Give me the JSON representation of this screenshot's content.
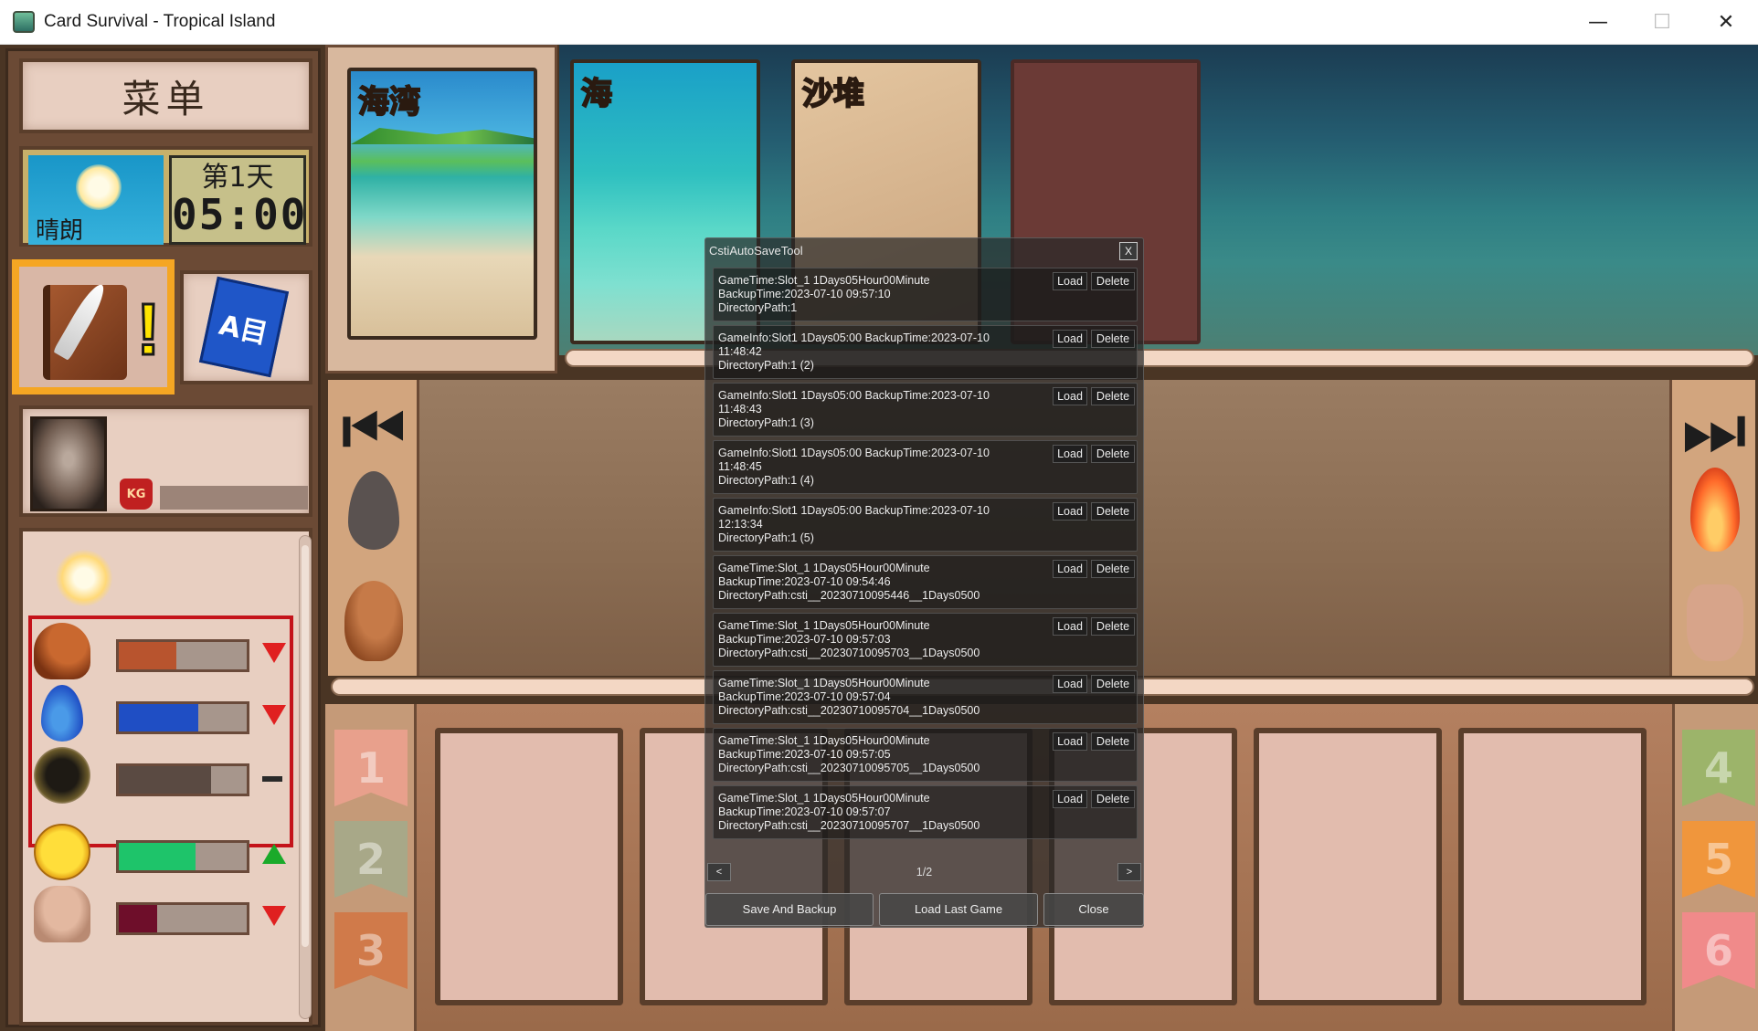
{
  "window": {
    "title": "Card Survival - Tropical Island",
    "minimize": "—",
    "maximize": "☐",
    "close": "✕"
  },
  "sidebar": {
    "menu_label": "菜单",
    "weather_label": "晴朗",
    "day_label": "第1天",
    "time_label": "05:00",
    "weight_badge": "KG",
    "guide_book_label": "A目"
  },
  "stats": [
    {
      "name": "food",
      "fill_percent": 45,
      "color": "#b8542e",
      "trend": "down"
    },
    {
      "name": "water",
      "fill_percent": 62,
      "color": "#1f4ec4",
      "trend": "down"
    },
    {
      "name": "stamina",
      "fill_percent": 72,
      "color": "#5a4a42",
      "trend": "flat"
    },
    {
      "name": "morale",
      "fill_percent": 60,
      "color": "#1ec46a",
      "trend": "up"
    },
    {
      "name": "health",
      "fill_percent": 30,
      "color": "#6e0e2a",
      "trend": "down"
    }
  ],
  "location_cards": {
    "bay": "海湾",
    "sea": "海",
    "sand": "沙堆"
  },
  "nav": {
    "prev": "⏮",
    "next": "⏭"
  },
  "tabs_left": [
    "1",
    "2",
    "3"
  ],
  "tabs_right": [
    "4",
    "5",
    "6"
  ],
  "dialog": {
    "title": "CstiAutoSaveTool",
    "close_label": "X",
    "load_label": "Load",
    "delete_label": "Delete",
    "entries": [
      "GameTime:Slot_1 1Days05Hour00Minute\nBackupTime:2023-07-10 09:57:10\nDirectoryPath:1",
      "GameInfo:Slot1 1Days05:00  BackupTime:2023-07-10\n11:48:42\nDirectoryPath:1 (2)",
      "GameInfo:Slot1 1Days05:00  BackupTime:2023-07-10\n11:48:43\nDirectoryPath:1 (3)",
      "GameInfo:Slot1 1Days05:00  BackupTime:2023-07-10\n11:48:45\nDirectoryPath:1 (4)",
      "GameInfo:Slot1 1Days05:00  BackupTime:2023-07-10\n12:13:34\nDirectoryPath:1 (5)",
      "GameTime:Slot_1 1Days05Hour00Minute\nBackupTime:2023-07-10 09:54:46\nDirectoryPath:csti__20230710095446__1Days0500",
      "GameTime:Slot_1 1Days05Hour00Minute\nBackupTime:2023-07-10 09:57:03\nDirectoryPath:csti__20230710095703__1Days0500",
      "GameTime:Slot_1 1Days05Hour00Minute\nBackupTime:2023-07-10 09:57:04\nDirectoryPath:csti__20230710095704__1Days0500",
      "GameTime:Slot_1 1Days05Hour00Minute\nBackupTime:2023-07-10 09:57:05\nDirectoryPath:csti__20230710095705__1Days0500",
      "GameTime:Slot_1 1Days05Hour00Minute\nBackupTime:2023-07-10 09:57:07\nDirectoryPath:csti__20230710095707__1Days0500"
    ],
    "page_prev": "<",
    "page_next": ">",
    "page_label": "1/2",
    "save_backup": "Save And Backup",
    "load_last": "Load Last Game",
    "close": "Close"
  }
}
